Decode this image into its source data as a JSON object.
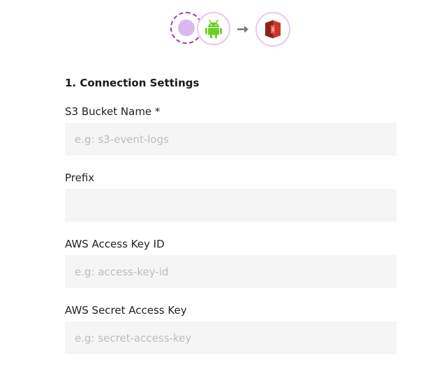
{
  "header": {
    "icons": [
      "source-placeholder-icon",
      "android-icon",
      "arrow-right-icon",
      "aws-s3-icon"
    ]
  },
  "form": {
    "section_title": "1. Connection Settings",
    "fields": [
      {
        "label": "S3 Bucket Name *",
        "placeholder": "e.g: s3-event-logs",
        "value": ""
      },
      {
        "label": "Prefix",
        "placeholder": "",
        "value": ""
      },
      {
        "label": "AWS Access Key ID",
        "placeholder": "e.g: access-key-id",
        "value": ""
      },
      {
        "label": "AWS Secret Access Key",
        "placeholder": "e.g: secret-access-key",
        "value": ""
      }
    ]
  },
  "colors": {
    "accent_purple": "#9b3cc4",
    "android_green": "#6fcf27",
    "s3_red": "#c7362a",
    "input_bg": "#f5f5f5"
  }
}
